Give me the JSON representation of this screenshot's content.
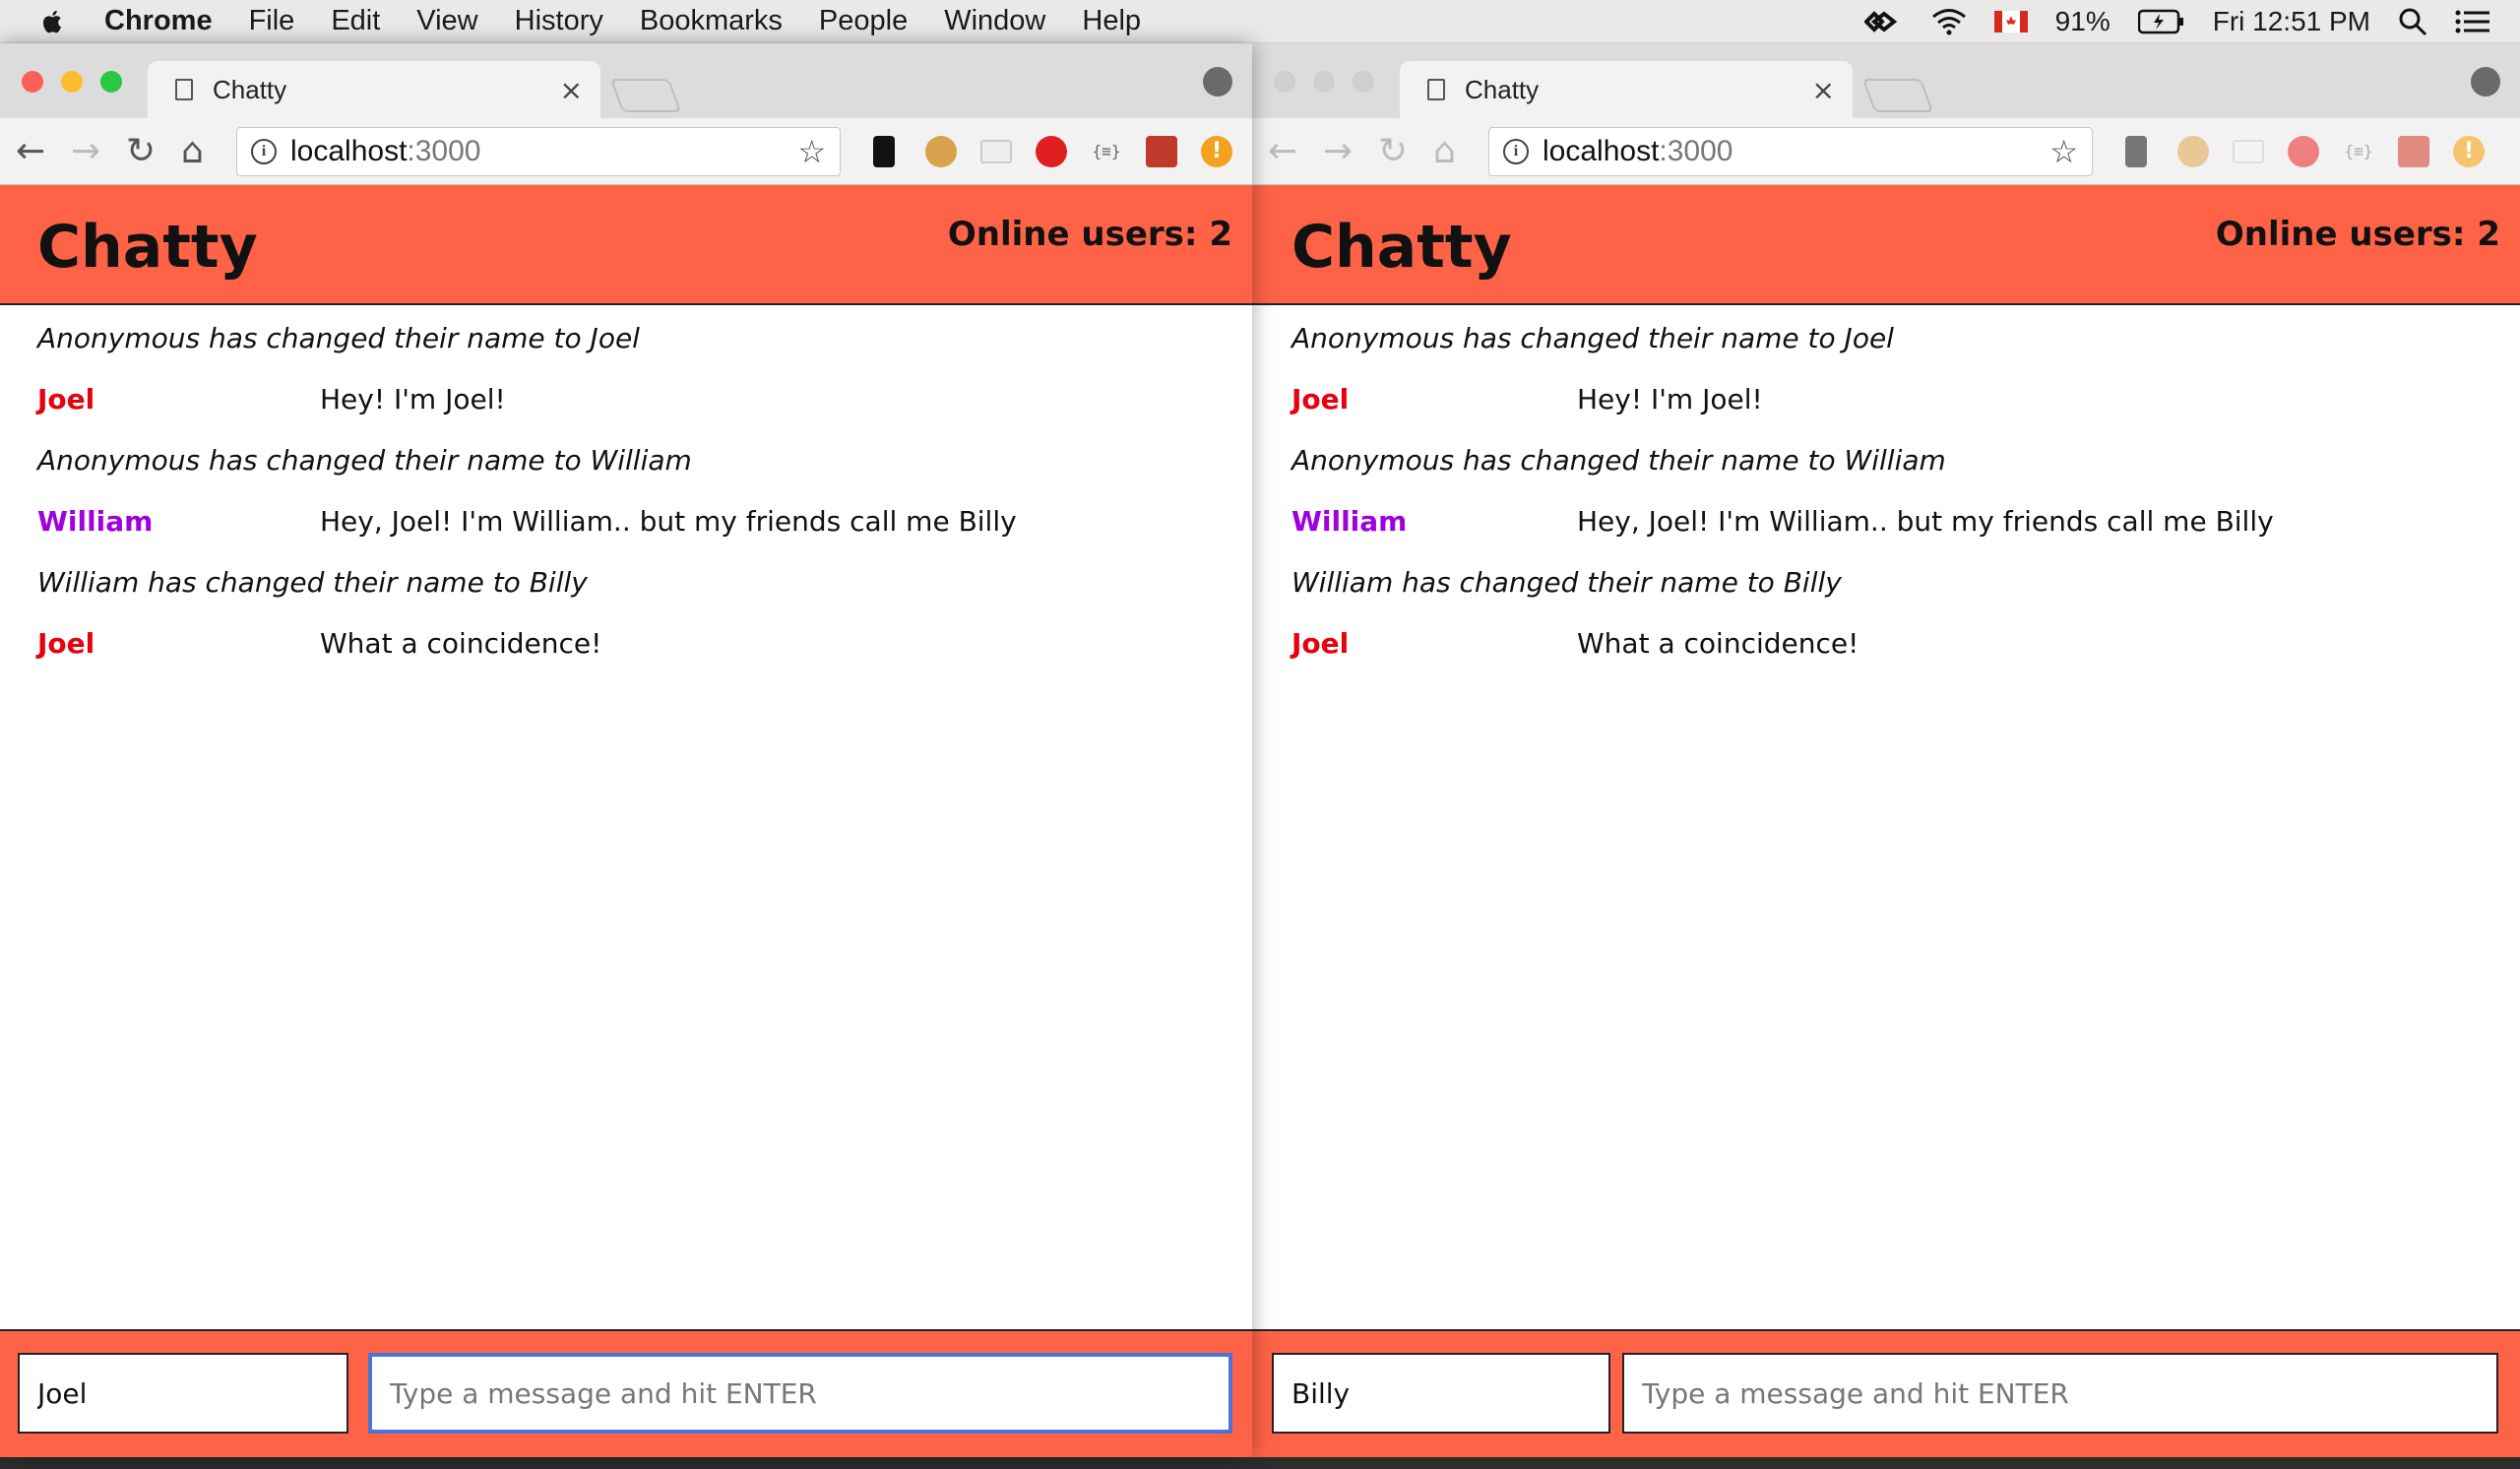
{
  "menubar": {
    "app": "Chrome",
    "items": [
      "File",
      "Edit",
      "View",
      "History",
      "Bookmarks",
      "People",
      "Window",
      "Help"
    ],
    "battery": "91%",
    "clock": "Fri 12:51 PM"
  },
  "windows": [
    {
      "tab_title": "Chatty",
      "url_host": "localhost",
      "url_port": ":3000",
      "app_title": "Chatty",
      "online": "Online users: 2",
      "username": "Joel",
      "message_placeholder": "Type a message and hit ENTER"
    },
    {
      "tab_title": "Chatty",
      "url_host": "localhost",
      "url_port": ":3000",
      "app_title": "Chatty",
      "online": "Online users: 2",
      "username": "Billy",
      "message_placeholder": "Type a message and hit ENTER"
    }
  ],
  "messages": [
    {
      "type": "notification",
      "content": "Anonymous has changed their name to Joel"
    },
    {
      "type": "message",
      "user": "Joel",
      "color": "#e8000f",
      "content": "Hey! I'm Joel!"
    },
    {
      "type": "notification",
      "content": "Anonymous has changed their name to William"
    },
    {
      "type": "message",
      "user": "William",
      "color": "#a000e0",
      "content": "Hey, Joel! I'm William.. but my friends call me Billy"
    },
    {
      "type": "notification",
      "content": "William has changed their name to Billy"
    },
    {
      "type": "message",
      "user": "Joel",
      "color": "#e8000f",
      "content": "What a coincidence!"
    }
  ],
  "colors": {
    "accent": "#ff6347",
    "joel": "#e8000f",
    "william": "#a000e0",
    "focus": "#4a74d6"
  },
  "icons": {
    "menubar": [
      "apple-icon",
      "wifi-icon",
      "flag-icon",
      "battery-icon",
      "search-icon",
      "list-icon"
    ],
    "toolbar": [
      "back-icon",
      "forward-icon",
      "reload-icon",
      "home-icon",
      "info-icon",
      "star-icon"
    ]
  }
}
